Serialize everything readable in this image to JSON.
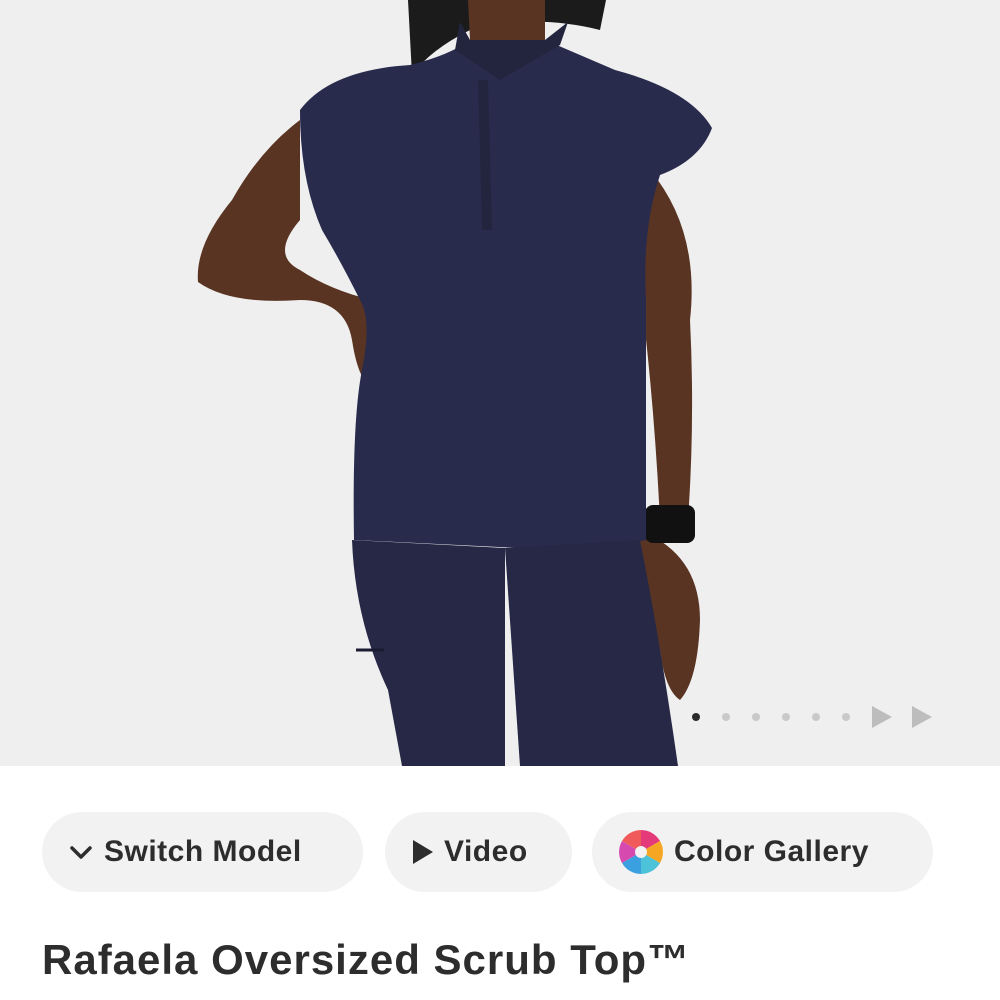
{
  "hero": {
    "image_alt": "Model wearing navy oversized scrub top and navy joggers",
    "carousel": {
      "total": 6,
      "active_index": 0
    }
  },
  "buttons": {
    "switch_model": "Switch Model",
    "video": "Video",
    "color_gallery": "Color Gallery"
  },
  "product": {
    "title": "Rafaela Oversized Scrub Top™"
  },
  "colors": {
    "navy": "#292b4d",
    "background": "#efefef",
    "pill_bg": "#f2f2f2",
    "text": "#2d2d2d"
  },
  "icons": {
    "switch_model": "chevron-down-icon",
    "video": "play-icon",
    "color_gallery": "color-wheel-icon"
  }
}
